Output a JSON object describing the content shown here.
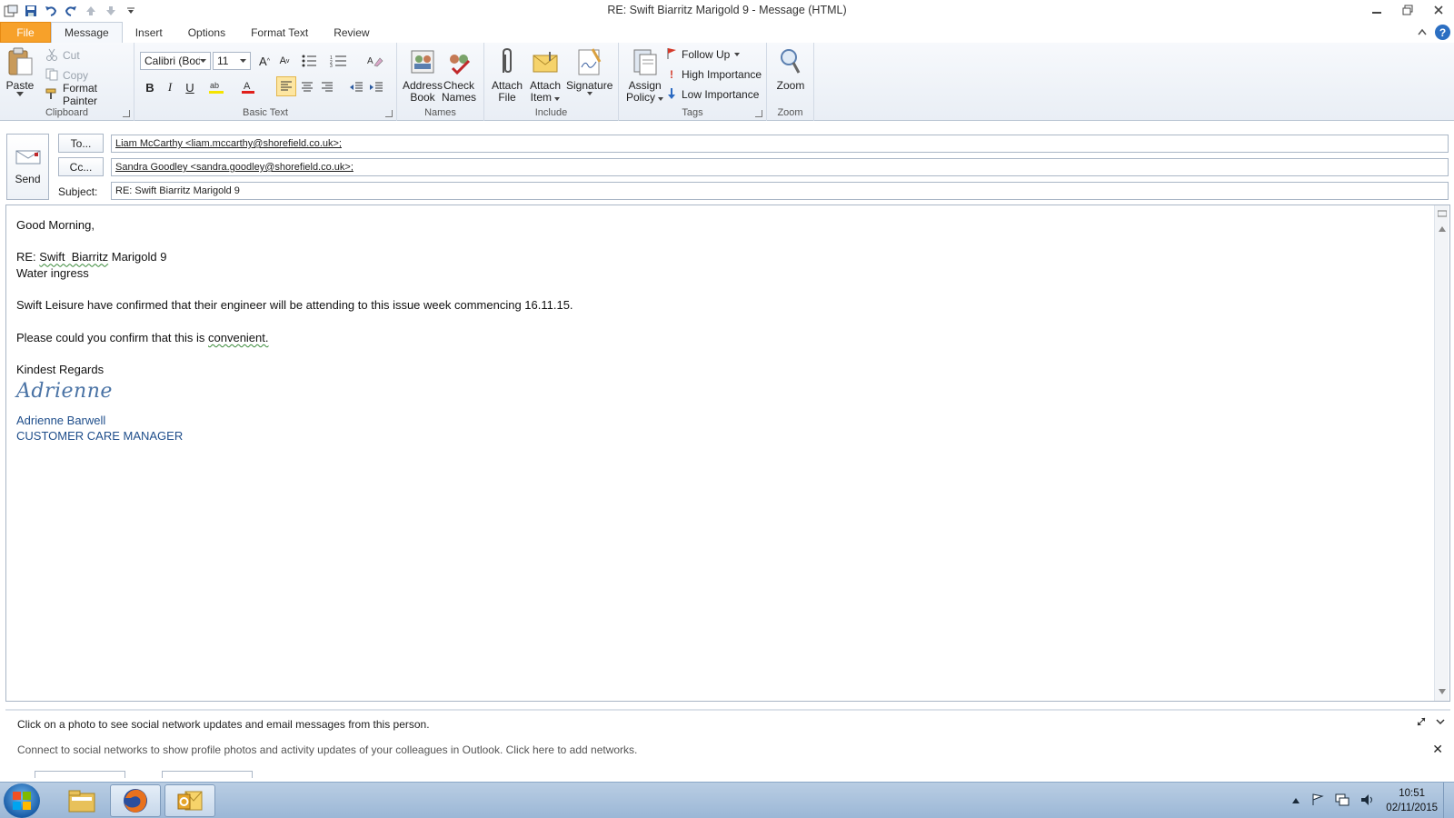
{
  "window": {
    "title": "RE: Swift  Biarritz Marigold 9  -  Message (HTML)"
  },
  "ribbon_tabs": [
    "File",
    "Message",
    "Insert",
    "Options",
    "Format Text",
    "Review"
  ],
  "ribbon": {
    "clipboard": {
      "label": "Clipboard",
      "paste": "Paste",
      "cut": "Cut",
      "copy": "Copy",
      "format_painter": "Format Painter"
    },
    "basic_text": {
      "label": "Basic Text",
      "font": "Calibri (Body)",
      "size": "11"
    },
    "names": {
      "label": "Names",
      "address_book": [
        "Address",
        "Book"
      ],
      "check_names": [
        "Check",
        "Names"
      ]
    },
    "include": {
      "label": "Include",
      "attach_file": [
        "Attach",
        "File"
      ],
      "attach_item": [
        "Attach",
        "Item"
      ],
      "signature": "Signature"
    },
    "tags": {
      "label": "Tags",
      "assign_policy": [
        "Assign",
        "Policy"
      ],
      "follow_up": "Follow Up",
      "high": "High Importance",
      "low": "Low Importance"
    },
    "zoom": {
      "label": "Zoom",
      "zoom": "Zoom"
    }
  },
  "compose": {
    "send": "Send",
    "to_button": "To...",
    "cc_button": "Cc...",
    "subject_label": "Subject:",
    "to_value": "Liam McCarthy <liam.mccarthy@shorefield.co.uk>;",
    "cc_value": "Sandra Goodley <sandra.goodley@shorefield.co.uk>;",
    "subject_value": "RE: Swift  Biarritz Marigold 9"
  },
  "body": {
    "greeting": "Good Morning,",
    "re_prefix": "RE: ",
    "re_swift": "Swift  Biarritz",
    "re_suffix": " Marigold 9",
    "issue": "Water ingress",
    "para1": "Swift Leisure have confirmed that their engineer will be attending to this issue week commencing 16.11.15.",
    "para2_a": "Please could you confirm that this is ",
    "para2_b": "convenient.",
    "closing": "Kindest Regards",
    "signature_script": "Adrienne",
    "sig_name": "Adrienne Barwell",
    "sig_title": "CUSTOMER CARE MANAGER"
  },
  "people_pane": {
    "line1": "Click on a photo to see social network updates and email messages from this person.",
    "line2": "Connect to social networks to show profile photos and activity updates of your colleagues in Outlook. Click here to add networks."
  },
  "taskbar": {
    "time": "10:51",
    "date": "02/11/2015"
  }
}
